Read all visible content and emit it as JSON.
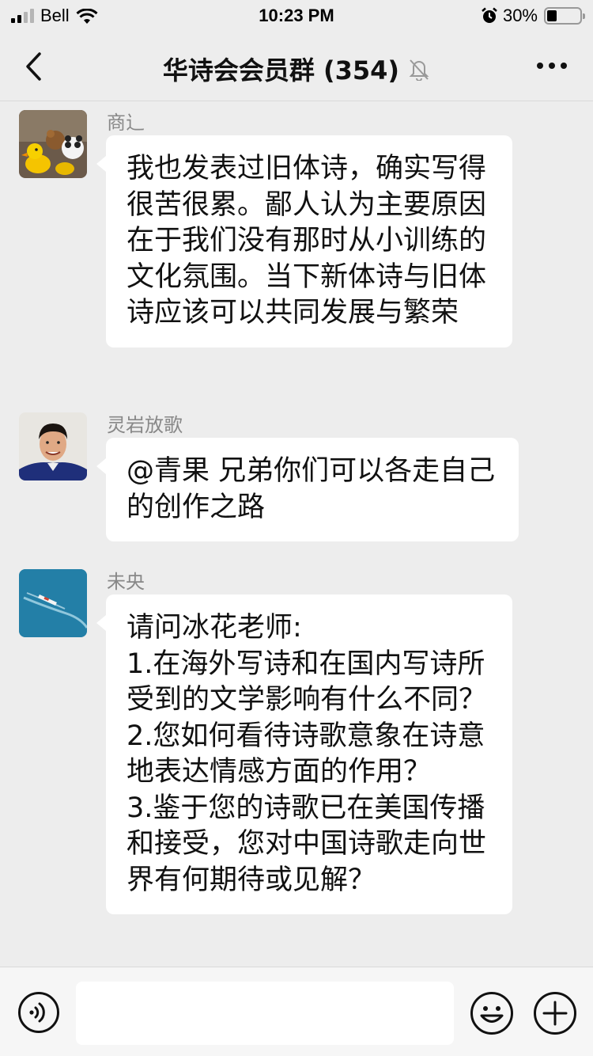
{
  "status_bar": {
    "carrier": "Bell",
    "time": "10:23 PM",
    "battery": "30%",
    "battery_level": 0.3
  },
  "nav": {
    "title": "华诗会会员群 (354)",
    "icons": [
      "back-chevron-icon",
      "mute-bell-icon",
      "more-dots-icon"
    ]
  },
  "messages": [
    {
      "sender": "商辶",
      "avatar": "toy-ducks-photo",
      "text": "我也发表过旧体诗，确实写得很苦很累。鄙人认为主要原因在于我们没有那时从小训练的文化氛围。当下新体诗与旧体诗应该可以共同发展与繁荣"
    },
    {
      "sender": "灵岩放歌",
      "avatar": "man-portrait-photo",
      "text": "@青果 兄弟你们可以各走自己的创作之路"
    },
    {
      "sender": "未央",
      "avatar": "boat-on-sea-photo",
      "text": "请问冰花老师:\n1.在海外写诗和在国内写诗所受到的文学影响有什么不同？\n2.您如何看待诗歌意象在诗意地表达情感方面的作用？\n3.鉴于您的诗歌已在美国传播和接受，您对中国诗歌走向世界有何期待或见解？"
    }
  ],
  "input_bar": {
    "placeholder": "",
    "value": "",
    "icons": [
      "voice-icon",
      "emoji-icon",
      "plus-icon"
    ]
  },
  "colors": {
    "background": "#ededed",
    "bubble": "#ffffff",
    "sender_name": "#888888"
  }
}
